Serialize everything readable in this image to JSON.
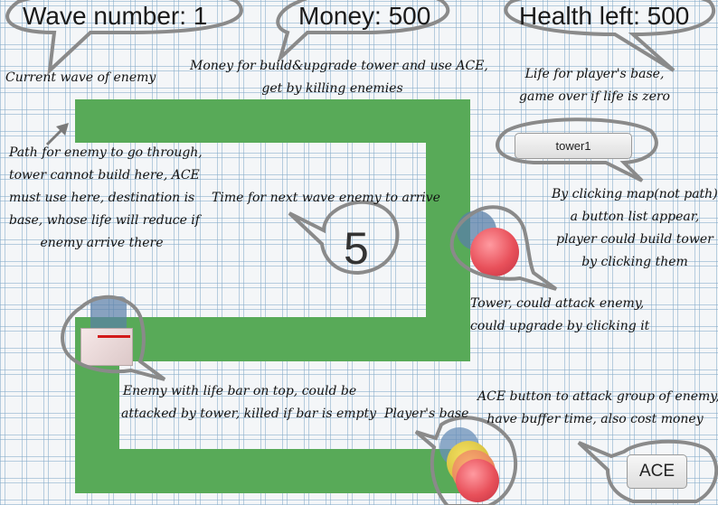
{
  "hud": {
    "wave": "Wave number: 1",
    "money": "Money: 500",
    "health": "Health left: 500"
  },
  "notes": {
    "wave": "Current wave of enemy",
    "money_line1": "Money for build&upgrade tower and use ACE,",
    "money_line2": "get by killing enemies",
    "health_line1": "Life for player's base,",
    "health_line2": "game over if life is zero",
    "path_line1": "Path for enemy to go through,",
    "path_line2": "tower cannot build here, ACE",
    "path_line3": "must use here, destination is",
    "path_line4": "base, whose life will reduce if",
    "path_line5": "enemy arrive there",
    "timer": "Time for next wave enemy to arrive",
    "build_line1": "By clicking map(not path),",
    "build_line2": "a button list appear,",
    "build_line3": "player could build tower",
    "build_line4": "by clicking them",
    "tower_line1": "Tower, could attack enemy,",
    "tower_line2": "could upgrade by clicking it",
    "enemy_line1": "Enemy with life bar on top, could be",
    "enemy_line2": "attacked by tower, killed if bar is empty",
    "base": "Player's base",
    "ace_line1": "ACE button to attack group of enemy,",
    "ace_line2": "have buffer time, also cost money"
  },
  "timer": {
    "value": "5"
  },
  "buttons": {
    "tower1": "tower1",
    "ace": "ACE"
  },
  "enemy": {
    "life_fraction": 1.0
  },
  "colors": {
    "path": "#58aa58",
    "tower": "#e8505a",
    "enemy_bar": "#d21a1a"
  }
}
